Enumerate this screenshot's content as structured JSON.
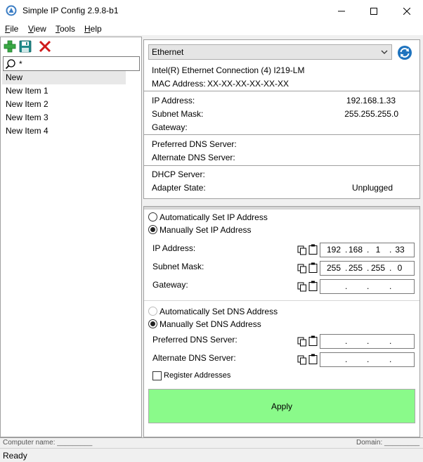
{
  "window": {
    "title": "Simple IP Config 2.9.8-b1"
  },
  "menu": {
    "file": "File",
    "view": "View",
    "tools": "Tools",
    "help": "Help"
  },
  "toolbar": {
    "icons": [
      "add-profile-icon",
      "save-profile-icon",
      "delete-profile-icon"
    ]
  },
  "search": {
    "value": "*"
  },
  "profiles": [
    "New",
    "New Item 1",
    "New Item 2",
    "New Item 3",
    "New Item 4"
  ],
  "adapter": {
    "selected": "Ethernet",
    "description": "Intel(R) Ethernet Connection (4) I219-LM",
    "mac_label": "MAC Address:",
    "mac_value": "XX-XX-XX-XX-XX-XX"
  },
  "current": {
    "ip_label": "IP Address:",
    "ip_value": "192.168.1.33",
    "subnet_label": "Subnet Mask:",
    "subnet_value": "255.255.255.0",
    "gateway_label": "Gateway:",
    "gateway_value": "",
    "pref_dns_label": "Preferred DNS Server:",
    "pref_dns_value": "",
    "alt_dns_label": "Alternate DNS Server:",
    "alt_dns_value": "",
    "dhcp_label": "DHCP Server:",
    "dhcp_value": "",
    "state_label": "Adapter State:",
    "state_value": "Unplugged"
  },
  "config": {
    "auto_ip_label": "Automatically Set IP Address",
    "manual_ip_label": "Manually Set IP Address",
    "ip_label": "IP Address:",
    "ip": [
      "192",
      "168",
      "1",
      "33"
    ],
    "subnet_label": "Subnet Mask:",
    "subnet": [
      "255",
      "255",
      "255",
      "0"
    ],
    "gateway_label": "Gateway:",
    "gateway": [
      "",
      "",
      "",
      ""
    ],
    "auto_dns_label": "Automatically Set DNS Address",
    "manual_dns_label": "Manually Set DNS Address",
    "pref_dns_label": "Preferred DNS Server:",
    "pref_dns": [
      "",
      "",
      "",
      ""
    ],
    "alt_dns_label": "Alternate DNS Server:",
    "alt_dns": [
      "",
      "",
      "",
      ""
    ],
    "register_label": "Register Addresses",
    "apply_label": "Apply"
  },
  "infobar": {
    "computer": "Computer name: _________",
    "domain": "Domain: _________"
  },
  "status": {
    "text": "Ready"
  },
  "colors": {
    "apply_bg": "#8afa8a",
    "accent_blue": "#1e73be"
  }
}
